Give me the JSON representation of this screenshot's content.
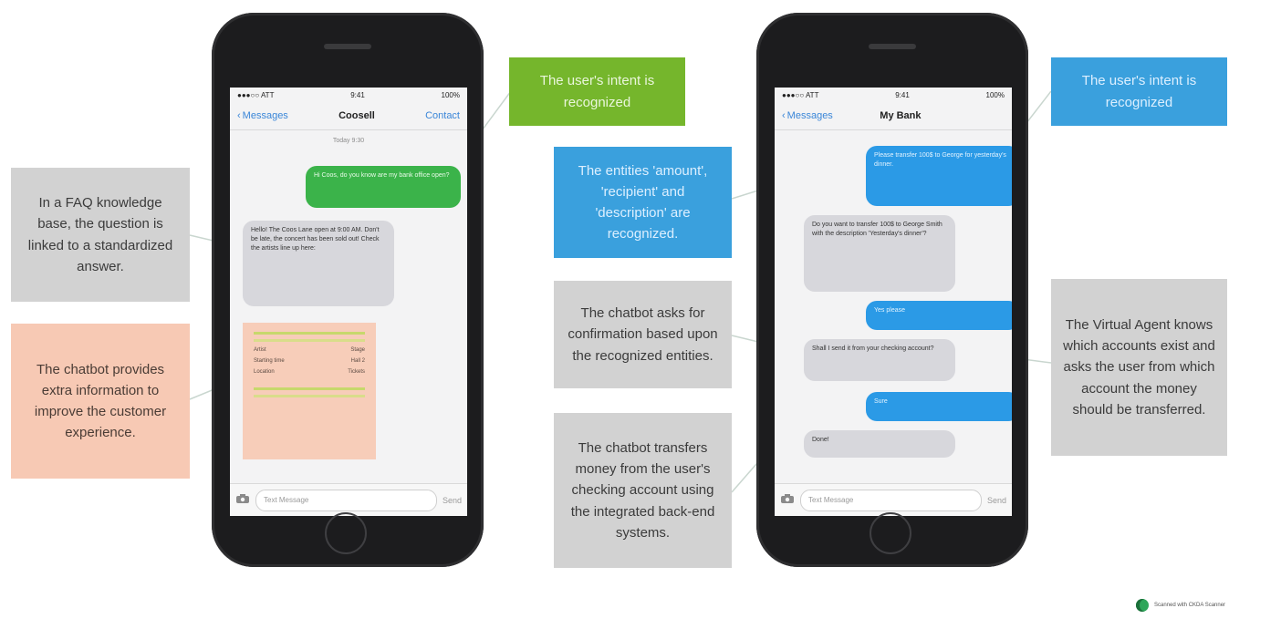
{
  "callouts": {
    "faq": "In a FAQ knowledge base, the question is linked to a standardized answer.",
    "extra_info": "The chatbot provides extra information to improve the customer experience.",
    "intent_left": "The user's intent is recognized",
    "entities": "The entities 'amount', 'recipient' and 'description' are recognized.",
    "confirmation": "The chatbot asks for confirmation based upon the recognized entities.",
    "transfers": "The chatbot transfers money from the user's checking account using the integrated back-end systems.",
    "intent_right": "The user's intent is recognized",
    "virtual_agent": "The Virtual Agent knows which accounts exist and asks the user from which account the money should be transferred."
  },
  "phone_left": {
    "carrier": "●●●○○ ATT",
    "time": "9:41",
    "battery": "100%",
    "back_label": "Messages",
    "title": "Coosell",
    "contact_label": "Contact",
    "timestamp": "Today 9:30",
    "user_message": "Hi Coos, do you know are my bank office open?",
    "bot_answer": "Hello! The Coos Lane open at 9:00 AM. Don't be late, the concert has been sold out! Check the artists line up here:",
    "card_rows": [
      {
        "left": "Artist",
        "right": "Stage"
      },
      {
        "left": "Starting time",
        "right": "Hall 2"
      },
      {
        "left": "Location",
        "right": "Tickets"
      }
    ],
    "input_placeholder": "Text Message",
    "send_label": "Send"
  },
  "phone_right": {
    "carrier": "●●●○○ ATT",
    "time": "9:41",
    "battery": "100%",
    "back_label": "Messages",
    "title": "My Bank",
    "user_request": "Please transfer 100$ to George for yesterday's dinner.",
    "bot_confirm_question": "Do you want to transfer 100$ to George Smith with the description 'Yesterday's dinner'?",
    "user_yes": "Yes please",
    "bot_account_question": "Shall I send it from your checking account?",
    "user_sure": "Sure",
    "bot_done": "Done!",
    "input_placeholder": "Text Message",
    "send_label": "Send"
  },
  "badge": {
    "label": "Scanned with CKDA Scanner"
  },
  "colors": {
    "grey_box": "#d2d2d2",
    "peach_box": "#f7c9b4",
    "green_box": "#75b62c",
    "blue_box": "#3aa0dd",
    "green_bubble": "#3bb34a",
    "blue_bubble": "#2b9ae6"
  }
}
